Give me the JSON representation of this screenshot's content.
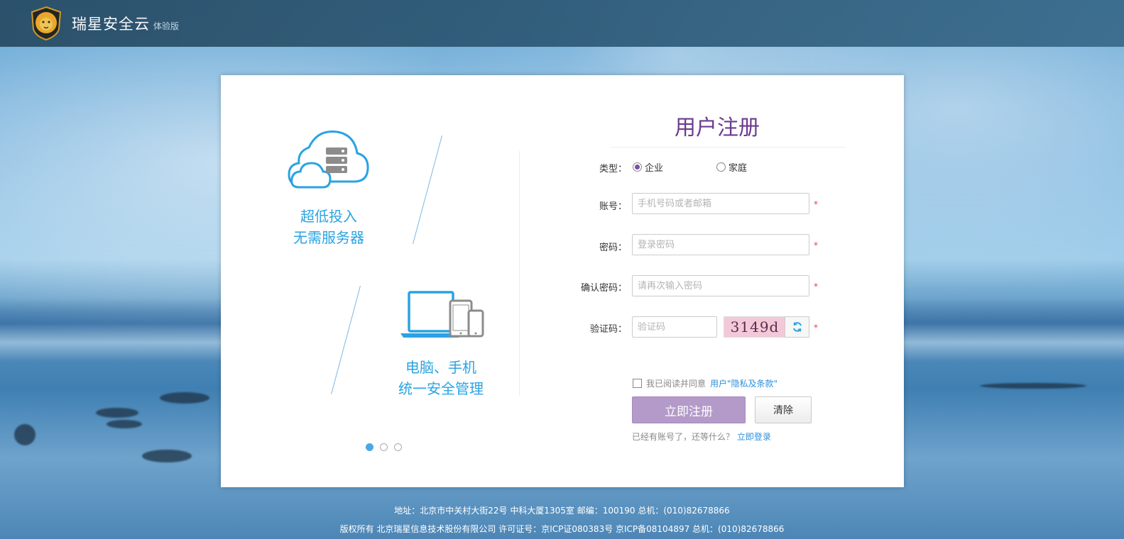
{
  "header": {
    "brand": "瑞星安全云",
    "edition": "体验版"
  },
  "carousel": {
    "feature1": [
      "超低投入",
      "无需服务器"
    ],
    "feature2": [
      "电脑、手机",
      "统一安全管理"
    ],
    "pages": 3,
    "active_page": 1
  },
  "form": {
    "title": "用户注册",
    "type_label": "类型：",
    "type_options": [
      "企业",
      "家庭"
    ],
    "type_selected": "企业",
    "account_label": "账号：",
    "account_placeholder": "手机号码或者邮箱",
    "password_label": "密码：",
    "password_placeholder": "登录密码",
    "confirm_label": "确认密码：",
    "confirm_placeholder": "请再次输入密码",
    "captcha_label": "验证码：",
    "captcha_placeholder": "验证码",
    "captcha_text": "3149d",
    "required_mark": "*",
    "agree_text": "我已阅读并同意",
    "agree_link": "用户\"隐私及条款\"",
    "submit_label": "立即注册",
    "clear_label": "清除",
    "login_hint": "已经有账号了，还等什么？",
    "login_link": "立即登录"
  },
  "footer": {
    "line1": "地址：北京市中关村大街22号 中科大厦1305室  邮编：100190  总机：(010)82678866",
    "line2": "版权所有 北京瑞星信息技术股份有限公司  许可证号：京ICP证080383号 京ICP备08104897  总机：(010)82678866"
  },
  "colors": {
    "header_bg": "#2f5b78",
    "title": "#6c3b8e",
    "accent_blue": "#2aa3e2",
    "submit_bg": "#b49ac9",
    "required": "#e04848"
  }
}
